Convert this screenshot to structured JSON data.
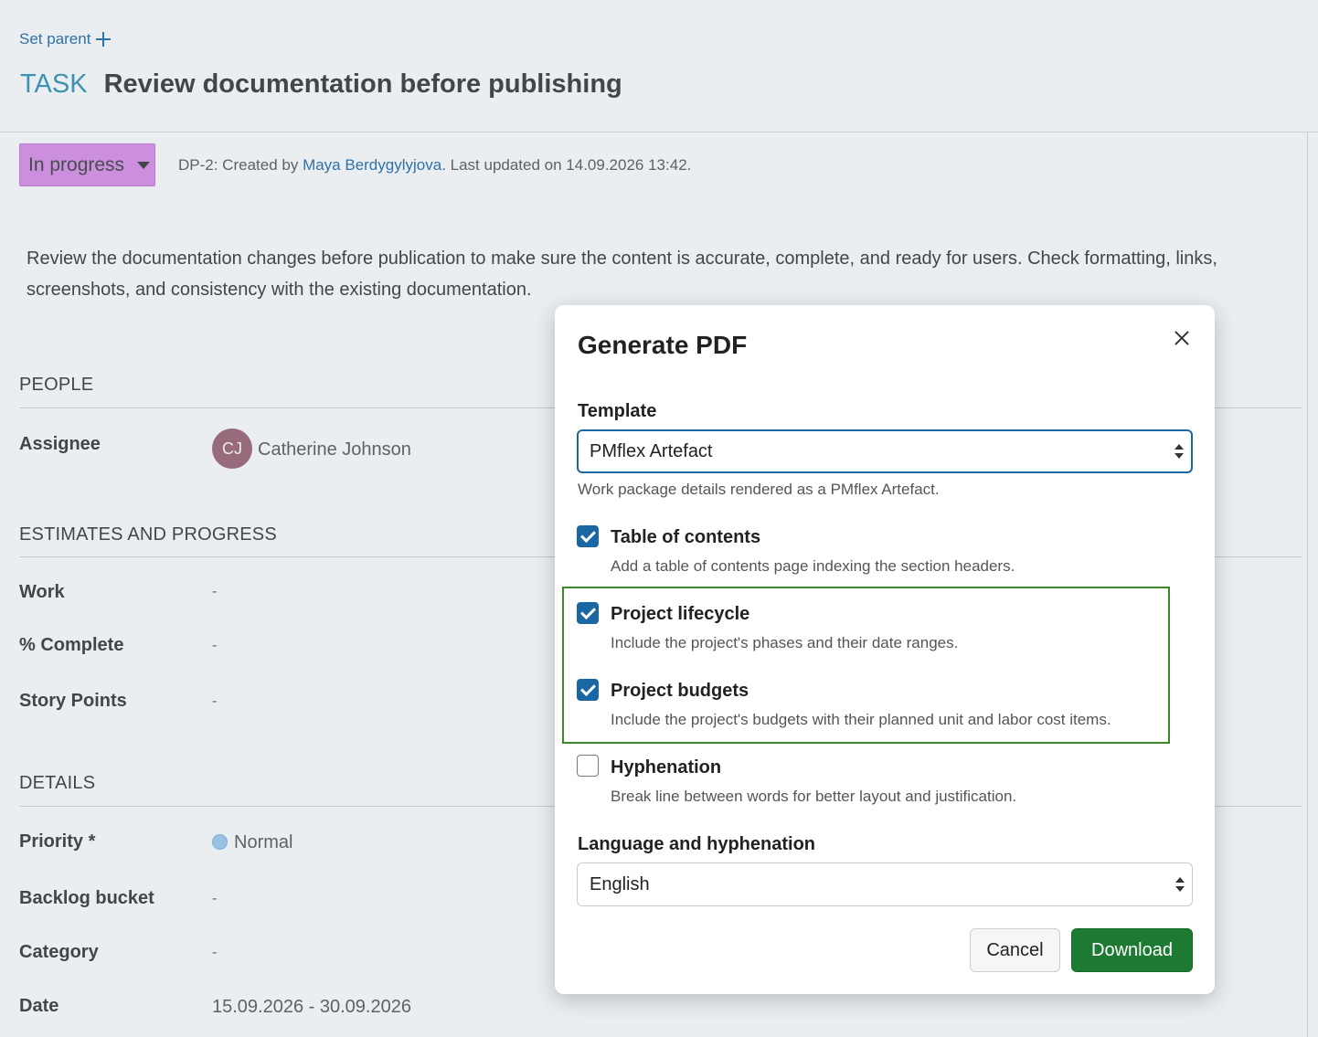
{
  "header": {
    "set_parent": "Set parent",
    "type": "TASK",
    "subject": "Review documentation before publishing"
  },
  "status": {
    "label": "In progress",
    "color": "#d98ce8"
  },
  "meta": {
    "prefix": "DP-2: Created by ",
    "author": "Maya Berdygylyjova",
    "suffix": ". Last updated on 14.09.2026 13:42."
  },
  "description": "Review the documentation changes before publication to make sure the content is accurate, complete, and ready for users. Check formatting, links, screenshots, and consistency with the existing documentation.",
  "sections": {
    "people": {
      "title": "PEOPLE",
      "assignee_label": "Assignee",
      "assignee_initials": "CJ",
      "assignee_name": "Catherine Johnson"
    },
    "estimates": {
      "title": "ESTIMATES AND PROGRESS",
      "work_label": "Work",
      "work_value": "-",
      "complete_label": "% Complete",
      "complete_value": "-",
      "story_label": "Story Points",
      "story_value": "-"
    },
    "details": {
      "title": "DETAILS",
      "priority_label": "Priority *",
      "priority_value": "Normal",
      "backlog_label": "Backlog bucket",
      "backlog_value": "-",
      "category_label": "Category",
      "category_value": "-",
      "date_label": "Date",
      "date_value": "15.09.2026 - 30.09.2026"
    }
  },
  "modal": {
    "title": "Generate PDF",
    "template_label": "Template",
    "template_value": "PMflex Artefact",
    "template_hint": "Work package details rendered as a PMflex Artefact.",
    "options": [
      {
        "label": "Table of contents",
        "desc": "Add a table of contents page indexing the section headers.",
        "checked": true
      },
      {
        "label": "Project lifecycle",
        "desc": "Include the project's phases and their date ranges.",
        "checked": true
      },
      {
        "label": "Project budgets",
        "desc": "Include the project's budgets with their planned unit and labor cost items.",
        "checked": true
      },
      {
        "label": "Hyphenation",
        "desc": "Break line between words for better layout and justification.",
        "checked": false
      }
    ],
    "language_label": "Language and hyphenation",
    "language_value": "English",
    "cancel_label": "Cancel",
    "download_label": "Download",
    "accent_color": "#1a67a3",
    "download_color": "#1d7a33"
  }
}
